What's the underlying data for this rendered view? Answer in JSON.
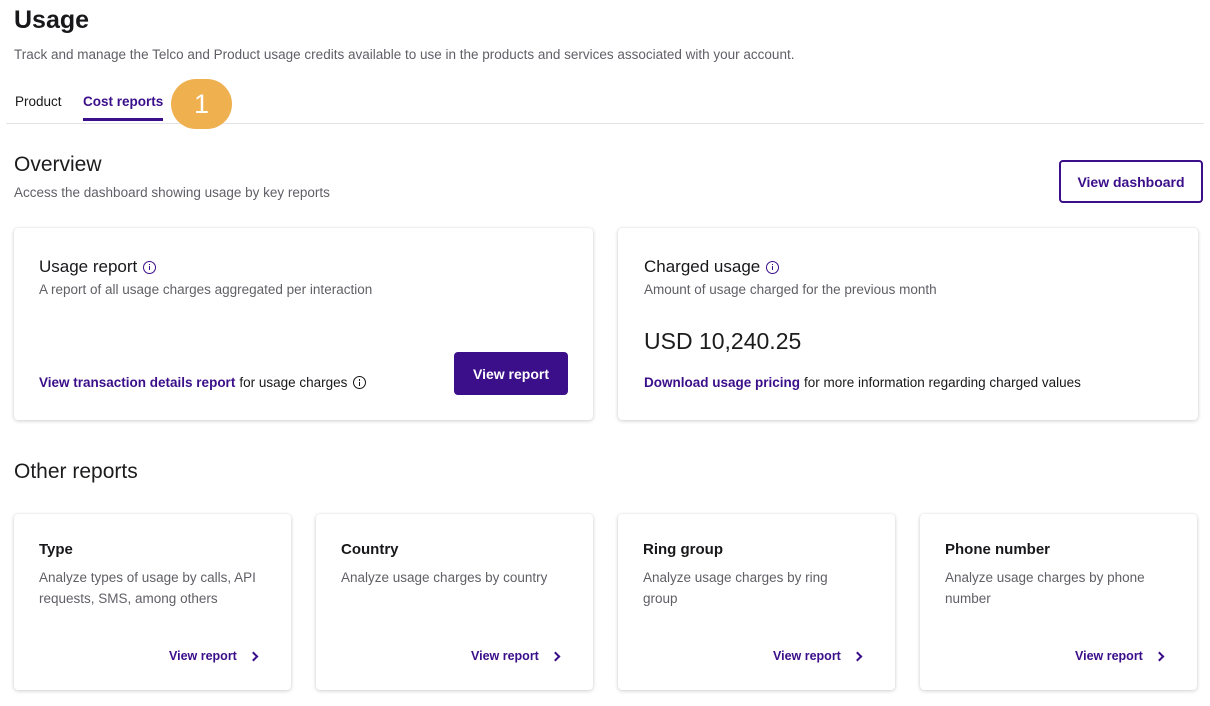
{
  "header": {
    "title": "Usage",
    "subtitle": "Track and manage the Telco and Product usage credits available to use in the products and services associated with your account."
  },
  "tabs": [
    {
      "label": "Product",
      "active": false
    },
    {
      "label": "Cost reports",
      "active": true
    }
  ],
  "step_badge": "1",
  "overview": {
    "title": "Overview",
    "subtitle": "Access the dashboard showing usage by key reports",
    "dashboard_button": "View dashboard",
    "usage_report": {
      "title": "Usage report",
      "description": "A report of all usage charges aggregated per interaction",
      "link_text": "View transaction details report",
      "link_suffix": "for usage charges",
      "button": "View report"
    },
    "charged_usage": {
      "title": "Charged usage",
      "description": "Amount of usage charged for the previous month",
      "amount": "USD 10,240.25",
      "link_text": "Download usage pricing",
      "link_suffix": "for more information regarding charged values"
    }
  },
  "other_reports": {
    "title": "Other reports",
    "items": [
      {
        "title": "Type",
        "description": "Analyze types of usage by calls, API requests, SMS, among others",
        "link": "View report"
      },
      {
        "title": "Country",
        "description": "Analyze usage charges by country",
        "link": "View report"
      },
      {
        "title": "Ring group",
        "description": "Analyze usage charges by ring group",
        "link": "View report"
      },
      {
        "title": "Phone number",
        "description": "Analyze usage charges by phone number",
        "link": "View report"
      }
    ]
  },
  "colors": {
    "accent": "#3b0e8a",
    "badge": "#efb04f"
  }
}
